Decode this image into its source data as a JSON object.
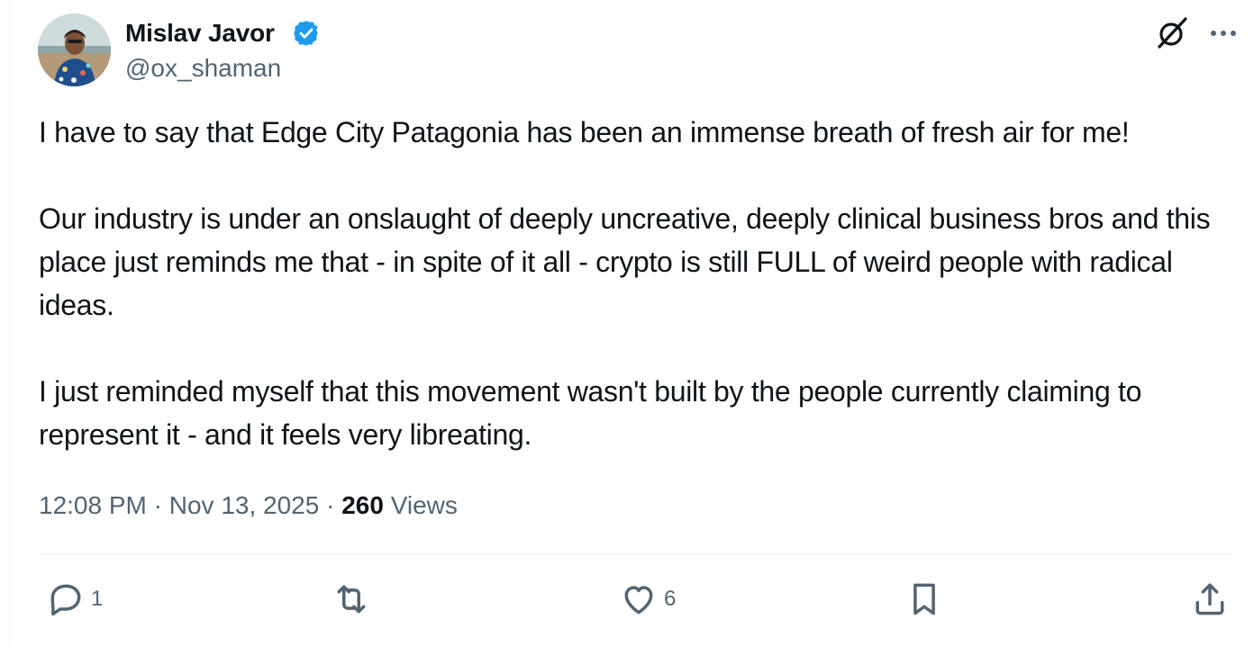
{
  "author": {
    "display_name": "Mislav Javor",
    "handle": "@ox_shaman",
    "verified": true
  },
  "tweet": {
    "text": "I have to say that Edge City Patagonia has been an immense breath of fresh air for me!\n\nOur industry is under an onslaught of deeply uncreative, deeply clinical business bros and this place just reminds me that - in spite of it all - crypto is still FULL of weird people with radical ideas.\n\nI just reminded myself that this movement wasn't built by the people currently claiming to represent it - and it feels very libreating.",
    "time": "12:08 PM",
    "date": "Nov 13, 2025",
    "separator": "·",
    "views_count": "260",
    "views_label": "Views"
  },
  "actions": {
    "reply_count": "1",
    "retweet_count": "",
    "like_count": "6"
  },
  "icons": {
    "verified": "verified-badge-icon",
    "grok": "grok-icon",
    "more": "more-options-icon",
    "reply": "reply-icon",
    "retweet": "retweet-icon",
    "like": "heart-icon",
    "bookmark": "bookmark-icon",
    "share": "share-icon"
  },
  "colors": {
    "verified": "#1d9bf0",
    "text_primary": "#0f1419",
    "text_secondary": "#536471"
  }
}
